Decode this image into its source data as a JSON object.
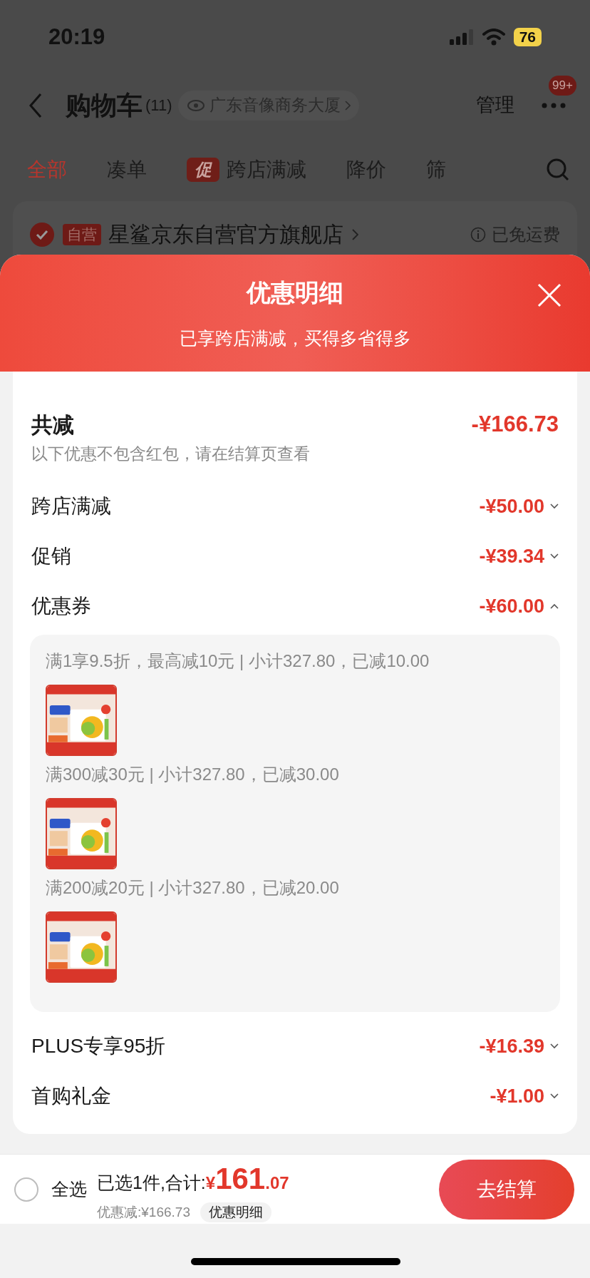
{
  "status_bar": {
    "time": "20:19",
    "battery": "76"
  },
  "header": {
    "title": "购物车",
    "count": "(11)",
    "location": "广东音像商务大厦",
    "manage": "管理",
    "more_badge": "99+"
  },
  "tabs": [
    {
      "label": "全部",
      "selected": true
    },
    {
      "label": "凑单",
      "selected": false
    },
    {
      "label": "跨店满减",
      "selected": false,
      "badge": "促"
    },
    {
      "label": "降价",
      "selected": false
    },
    {
      "label": "筛",
      "selected": false
    }
  ],
  "store": {
    "checked": true,
    "tag": "自营",
    "name": "星鲨京东自营官方旗舰店",
    "shipping": "已免运费"
  },
  "sheet": {
    "title": "优惠明细",
    "subtitle": "已享跨店满减，买得多省得多",
    "total": {
      "label": "共减",
      "amount": "-¥166.73"
    },
    "note": "以下优惠不包含红包，请在结算页查看",
    "items": [
      {
        "label": "跨店满减",
        "amount": "-¥50.00",
        "expanded": false
      },
      {
        "label": "促销",
        "amount": "-¥39.34",
        "expanded": false
      },
      {
        "label": "优惠券",
        "amount": "-¥60.00",
        "expanded": true,
        "details": [
          {
            "text": "满1享9.5折，最高减10元 | 小计327.80，已减10.00"
          },
          {
            "text": "满300减30元 | 小计327.80，已减30.00"
          },
          {
            "text": "满200减20元 | 小计327.80，已减20.00"
          }
        ]
      },
      {
        "label": "PLUS专享95折",
        "amount": "-¥16.39",
        "expanded": false
      },
      {
        "label": "首购礼金",
        "amount": "-¥1.00",
        "expanded": false
      }
    ]
  },
  "footer": {
    "select_all": {
      "label": "全选",
      "checked": false
    },
    "summary": "已选1件,合计:",
    "currency": "¥",
    "price_int": "161",
    "price_dec": ".07",
    "discount": "优惠减:¥166.73",
    "detail_chip": "优惠明细",
    "checkout": "去结算"
  }
}
